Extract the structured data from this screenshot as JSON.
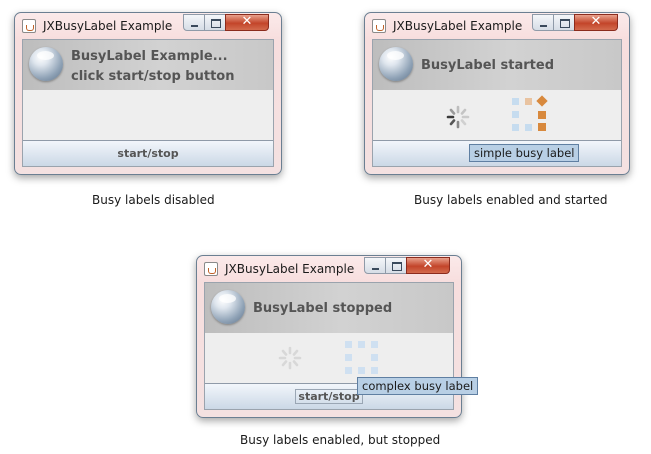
{
  "windows": [
    {
      "title": "JXBusyLabel Example",
      "header_line1": "BusyLabel Example...",
      "header_line2": "click start/stop button",
      "button_label": "start/stop",
      "caption": "Busy labels disabled"
    },
    {
      "title": "JXBusyLabel Example",
      "header_line1": "BusyLabel started",
      "tooltip": "simple busy label",
      "caption": "Busy labels enabled and started"
    },
    {
      "title": "JXBusyLabel Example",
      "header_line1": "BusyLabel stopped",
      "button_label": "start/stop",
      "tooltip": "complex busy label",
      "caption": "Busy labels enabled, but stopped"
    }
  ],
  "icons": {
    "app": "java-cup-icon",
    "header": "globe-orb-icon",
    "minimize": "minimize-icon",
    "maximize": "maximize-icon",
    "close": "close-icon",
    "spinner": "spinner-busy-icon",
    "grid": "grid-busy-icon"
  },
  "colors": {
    "close_button": "#c3452a",
    "tooltip_bg": "#b8cfe5",
    "grid_active": "#d8893d",
    "grid_inactive": "#c6dcef"
  },
  "close_glyph": "✕"
}
